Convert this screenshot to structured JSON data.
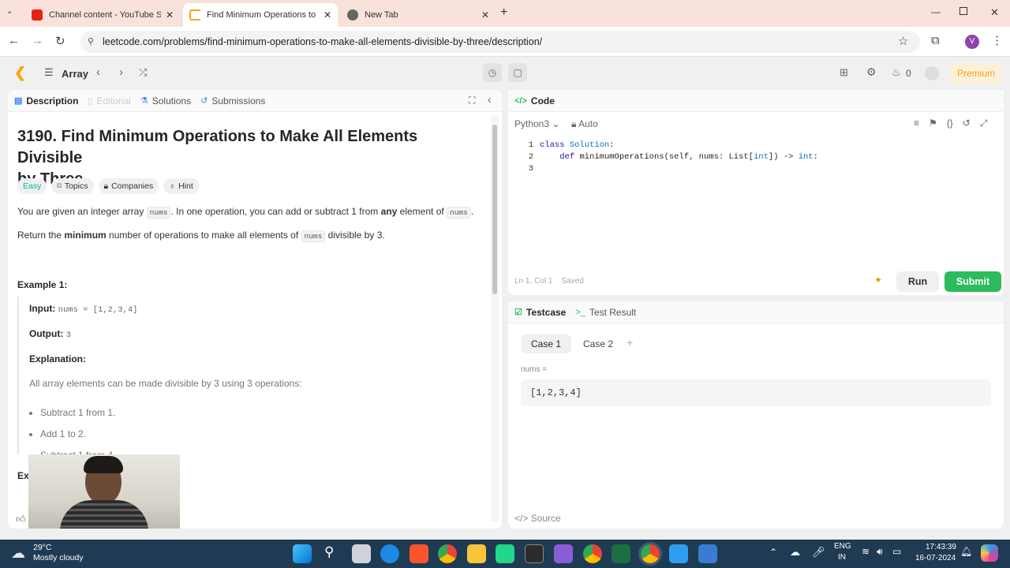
{
  "browser": {
    "tabs": [
      {
        "title": "Channel content - YouTube Stu",
        "icon": "youtube-icon"
      },
      {
        "title": "Find Minimum Operations to M",
        "icon": "leetcode-icon"
      },
      {
        "title": "New Tab",
        "icon": "chrome-icon"
      }
    ],
    "url": "leetcode.com/problems/find-minimum-operations-to-make-all-elements-divisible-by-three/description/",
    "profile_initial": "V"
  },
  "toolbar": {
    "list_label": "Array",
    "fire_count": "0",
    "premium_label": "Premium"
  },
  "left": {
    "tabs": {
      "description": "Description",
      "editorial": "Editorial",
      "solutions": "Solutions",
      "submissions": "Submissions"
    },
    "title_line1": "3190. Find Minimum Operations to Make All Elements Divisible",
    "title_line2": "by Three",
    "chips": {
      "difficulty": "Easy",
      "topics": "Topics",
      "companies": "Companies",
      "hint": "Hint"
    },
    "p1": {
      "a": "You are given an integer array ",
      "code1": "nums",
      "b": ". In one operation, you can add or subtract 1 from ",
      "bold": "any",
      "c": " element of ",
      "code2": "nums",
      "d": "."
    },
    "p2": {
      "a": "Return the ",
      "bold": "minimum",
      "b": " number of operations to make all elements of ",
      "code": "nums",
      "c": " divisible by 3."
    },
    "example1": {
      "heading": "Example 1:",
      "input_label": "Input:",
      "input_value": "nums = [1,2,3,4]",
      "output_label": "Output:",
      "output_value": "3",
      "explanation_label": "Explanation:",
      "explanation_text": "All array elements can be made divisible by 3 using 3 operations:",
      "bullets": [
        "Subtract 1 from 1.",
        "Add 1 to 2.",
        "Subtract 1 from 4."
      ]
    },
    "example2_heading_partial": "Exa"
  },
  "code": {
    "tab_label": "Code",
    "language": "Python3",
    "mode": "Auto",
    "lines": [
      "1",
      "2",
      "3"
    ],
    "status_pos": "Ln 1, Col 1",
    "status_saved": "Saved",
    "run_label": "Run",
    "submit_label": "Submit"
  },
  "testcase": {
    "tab_testcase": "Testcase",
    "tab_result": "Test Result",
    "case1": "Case 1",
    "case2": "Case 2",
    "param_label": "nums =",
    "param_value": "[1,2,3,4]",
    "source_label": "Source"
  },
  "taskbar": {
    "weather_temp": "29°C",
    "weather_desc": "Mostly cloudy",
    "lang1": "ENG",
    "lang2": "IN",
    "time": "17:43:39",
    "date": "16-07-2024"
  }
}
